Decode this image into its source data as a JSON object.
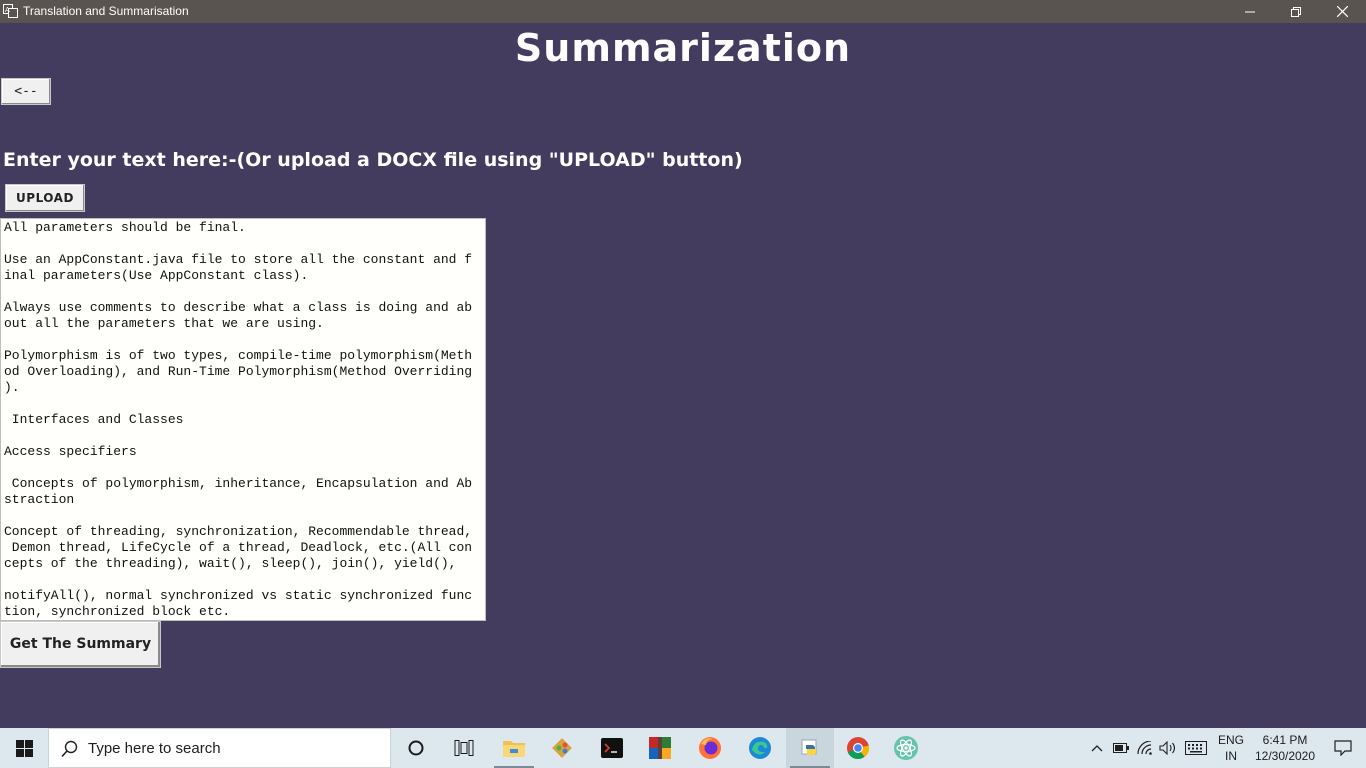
{
  "window": {
    "title": "Translation and Summarisation",
    "controls": {
      "minimize_icon": "minimize-icon",
      "restore_icon": "restore-icon",
      "close_icon": "close-icon"
    }
  },
  "app": {
    "heading": "Summarization",
    "back_label": "<--",
    "prompt": "Enter your text here:-(Or upload a DOCX file using \"UPLOAD\" button)",
    "upload_label": "UPLOAD",
    "text_content": "All parameters should be final.\n\nUse an AppConstant.java file to store all the constant and f\ninal parameters(Use AppConstant class).\n\nAlways use comments to describe what a class is doing and ab\nout all the parameters that we are using.\n\nPolymorphism is of two types, compile-time polymorphism(Meth\nod Overloading), and Run-Time Polymorphism(Method Overriding\n).\n\n Interfaces and Classes\n\nAccess specifiers\n\n Concepts of polymorphism, inheritance, Encapsulation and Ab\nstraction\n\nConcept of threading, synchronization, Recommendable thread,\n Demon thread, LifeCycle of a thread, Deadlock, etc.(All con\ncepts of the threading), wait(), sleep(), join(), yield(),\n\nnotifyAll(), normal synchronized vs static synchronized func\ntion, synchronized block etc.",
    "summary_label": "Get The Summary"
  },
  "taskbar": {
    "search_placeholder": "Type here to search",
    "apps": [
      "cortana-icon",
      "task-view-icon",
      "file-explorer-icon",
      "git-icon",
      "terminal-icon",
      "winrar-icon",
      "firefox-icon",
      "edge-icon",
      "python-icon",
      "chrome-icon",
      "atom-icon"
    ],
    "language_line1": "ENG",
    "language_line2": "IN",
    "time": "6:41 PM",
    "date": "12/30/2020"
  },
  "colors": {
    "background": "#443c5e",
    "titlebar": "#5a5450",
    "taskbar": "#dde8ee"
  }
}
